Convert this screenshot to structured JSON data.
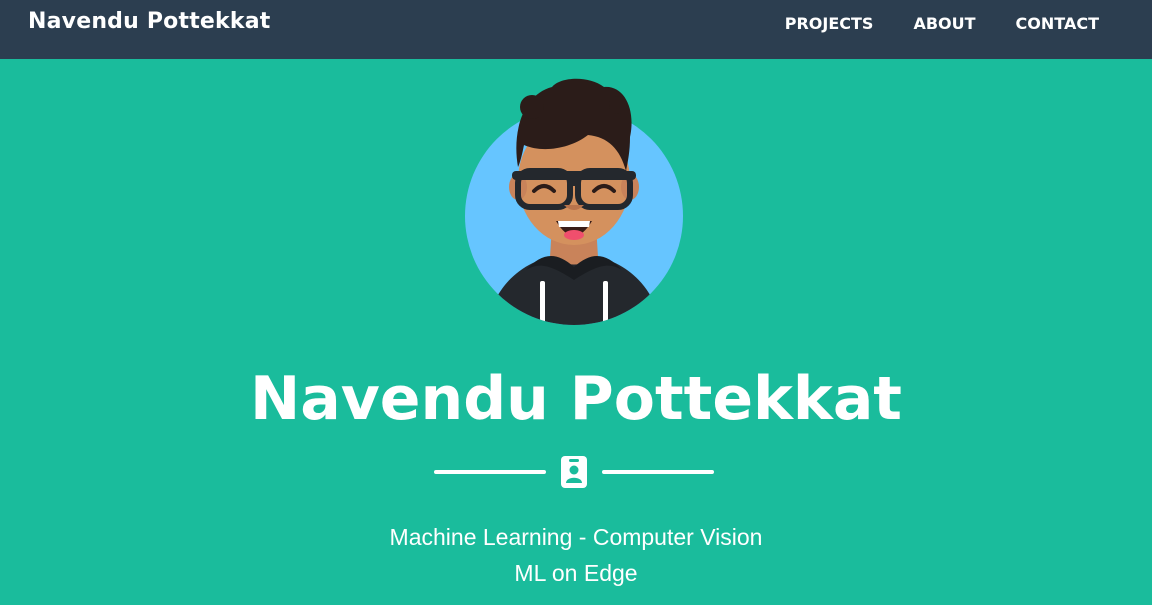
{
  "navbar": {
    "brand": "Navendu Pottekkat",
    "links": [
      {
        "label": "PROJECTS"
      },
      {
        "label": "ABOUT"
      },
      {
        "label": "CONTACT"
      }
    ]
  },
  "hero": {
    "heading": "Navendu Pottekkat",
    "divider_icon": "id-badge-icon",
    "subheadings": [
      "Machine Learning - Computer Vision",
      "ML on Edge"
    ]
  },
  "colors": {
    "background": "#1abc9c",
    "navbar": "#2c3e50",
    "text": "#ffffff",
    "avatar_circle": "#66c5ff"
  }
}
